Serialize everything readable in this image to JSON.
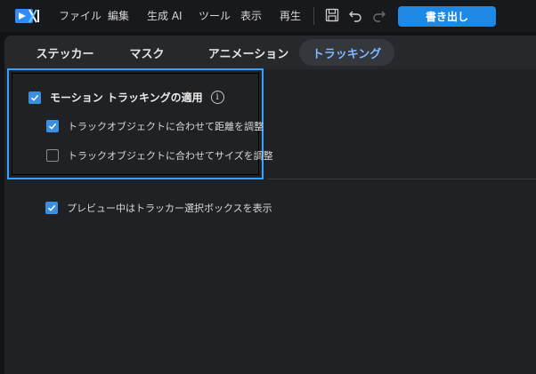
{
  "menubar": {
    "items": [
      "ファイル",
      "編集",
      "生成 AI",
      "ツール",
      "表示",
      "再生"
    ],
    "export_label": "書き出し"
  },
  "tabs": [
    {
      "label": "ステッカー",
      "active": false
    },
    {
      "label": "マスク",
      "active": false
    },
    {
      "label": "アニメーション",
      "active": false
    },
    {
      "label": "トラッキング",
      "active": true
    }
  ],
  "tracking": {
    "apply_label": "モーション トラッキングの適用",
    "apply_checked": true,
    "options": [
      {
        "label": "トラックオブジェクトに合わせて距離を調整",
        "checked": true
      },
      {
        "label": "トラックオブジェクトに合わせてサイズを調整",
        "checked": false
      }
    ],
    "preview_label": "プレビュー中はトラッカー選択ボックスを表示",
    "preview_checked": true
  },
  "colors": {
    "accent": "#1e88e5",
    "checkbox": "#3a8fe0",
    "highlight": "#3aa0ff",
    "active_tab_text": "#7fb8ff"
  }
}
